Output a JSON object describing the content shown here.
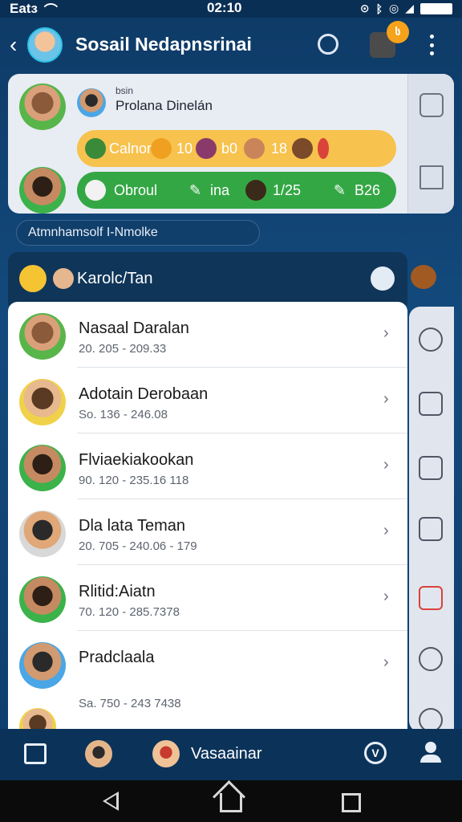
{
  "status_bar": {
    "carrier": "Eatз",
    "time": "02:10"
  },
  "header": {
    "title": "Sosail Nedapnsrinai",
    "badge_count": "ს"
  },
  "profile": {
    "subtitle": "bsin",
    "name": "Prolana Dinelán"
  },
  "stats_yellow": {
    "label": "Calnor",
    "value_1": "10",
    "value_2": "b0",
    "value_3": "18"
  },
  "stats_green": {
    "label": "Obroul",
    "value_1": "ina",
    "value_2": "1/25",
    "value_3": "B26"
  },
  "search": {
    "placeholder": "Atmnhamsolf I-Nmolke"
  },
  "list": {
    "title": "Karolc/Tan",
    "rows": [
      {
        "name": "Nasaal Daralan",
        "meta": "20. 205 - 209.33"
      },
      {
        "name": "Adotain Derobaan",
        "meta": "So. 136 - 246.08"
      },
      {
        "name": "Flviaekiakookan",
        "meta": "90. 120 - 235.16  118"
      },
      {
        "name": "Dla lata Teman",
        "meta": "20. 705 - 240.06 - 179"
      },
      {
        "name": "Rlitid:Aiatn",
        "meta": "70. 120 - 285.7378"
      },
      {
        "name": "Pradclaala",
        "meta": ""
      },
      {
        "name": "",
        "meta": "Sa. 750 - 243 7438"
      }
    ]
  },
  "bottom_nav": {
    "label": "Vasaainar",
    "v_icon": "V"
  },
  "colors": {
    "background": "#0e3a66",
    "yellow_pill": "#f7c24d",
    "green_pill": "#34a745",
    "badge": "#f6a21a"
  },
  "icons": [
    "back-icon",
    "sync-icon",
    "more-icon",
    "home-icon",
    "filter-icon",
    "user-icon"
  ]
}
